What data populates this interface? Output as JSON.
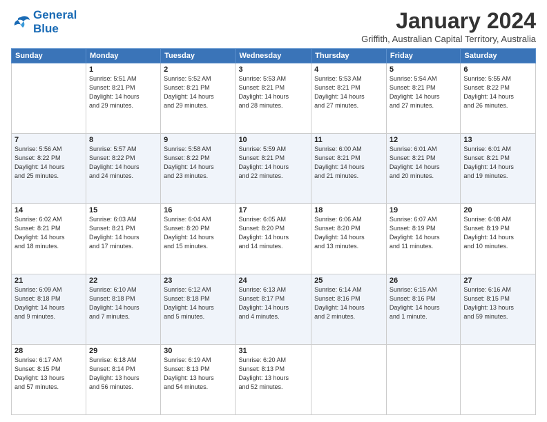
{
  "logo": {
    "line1": "General",
    "line2": "Blue"
  },
  "title": "January 2024",
  "location": "Griffith, Australian Capital Territory, Australia",
  "days_of_week": [
    "Sunday",
    "Monday",
    "Tuesday",
    "Wednesday",
    "Thursday",
    "Friday",
    "Saturday"
  ],
  "weeks": [
    [
      {
        "day": "",
        "info": ""
      },
      {
        "day": "1",
        "info": "Sunrise: 5:51 AM\nSunset: 8:21 PM\nDaylight: 14 hours\nand 29 minutes."
      },
      {
        "day": "2",
        "info": "Sunrise: 5:52 AM\nSunset: 8:21 PM\nDaylight: 14 hours\nand 29 minutes."
      },
      {
        "day": "3",
        "info": "Sunrise: 5:53 AM\nSunset: 8:21 PM\nDaylight: 14 hours\nand 28 minutes."
      },
      {
        "day": "4",
        "info": "Sunrise: 5:53 AM\nSunset: 8:21 PM\nDaylight: 14 hours\nand 27 minutes."
      },
      {
        "day": "5",
        "info": "Sunrise: 5:54 AM\nSunset: 8:21 PM\nDaylight: 14 hours\nand 27 minutes."
      },
      {
        "day": "6",
        "info": "Sunrise: 5:55 AM\nSunset: 8:22 PM\nDaylight: 14 hours\nand 26 minutes."
      }
    ],
    [
      {
        "day": "7",
        "info": "Sunrise: 5:56 AM\nSunset: 8:22 PM\nDaylight: 14 hours\nand 25 minutes."
      },
      {
        "day": "8",
        "info": "Sunrise: 5:57 AM\nSunset: 8:22 PM\nDaylight: 14 hours\nand 24 minutes."
      },
      {
        "day": "9",
        "info": "Sunrise: 5:58 AM\nSunset: 8:22 PM\nDaylight: 14 hours\nand 23 minutes."
      },
      {
        "day": "10",
        "info": "Sunrise: 5:59 AM\nSunset: 8:21 PM\nDaylight: 14 hours\nand 22 minutes."
      },
      {
        "day": "11",
        "info": "Sunrise: 6:00 AM\nSunset: 8:21 PM\nDaylight: 14 hours\nand 21 minutes."
      },
      {
        "day": "12",
        "info": "Sunrise: 6:01 AM\nSunset: 8:21 PM\nDaylight: 14 hours\nand 20 minutes."
      },
      {
        "day": "13",
        "info": "Sunrise: 6:01 AM\nSunset: 8:21 PM\nDaylight: 14 hours\nand 19 minutes."
      }
    ],
    [
      {
        "day": "14",
        "info": "Sunrise: 6:02 AM\nSunset: 8:21 PM\nDaylight: 14 hours\nand 18 minutes."
      },
      {
        "day": "15",
        "info": "Sunrise: 6:03 AM\nSunset: 8:21 PM\nDaylight: 14 hours\nand 17 minutes."
      },
      {
        "day": "16",
        "info": "Sunrise: 6:04 AM\nSunset: 8:20 PM\nDaylight: 14 hours\nand 15 minutes."
      },
      {
        "day": "17",
        "info": "Sunrise: 6:05 AM\nSunset: 8:20 PM\nDaylight: 14 hours\nand 14 minutes."
      },
      {
        "day": "18",
        "info": "Sunrise: 6:06 AM\nSunset: 8:20 PM\nDaylight: 14 hours\nand 13 minutes."
      },
      {
        "day": "19",
        "info": "Sunrise: 6:07 AM\nSunset: 8:19 PM\nDaylight: 14 hours\nand 11 minutes."
      },
      {
        "day": "20",
        "info": "Sunrise: 6:08 AM\nSunset: 8:19 PM\nDaylight: 14 hours\nand 10 minutes."
      }
    ],
    [
      {
        "day": "21",
        "info": "Sunrise: 6:09 AM\nSunset: 8:18 PM\nDaylight: 14 hours\nand 9 minutes."
      },
      {
        "day": "22",
        "info": "Sunrise: 6:10 AM\nSunset: 8:18 PM\nDaylight: 14 hours\nand 7 minutes."
      },
      {
        "day": "23",
        "info": "Sunrise: 6:12 AM\nSunset: 8:18 PM\nDaylight: 14 hours\nand 5 minutes."
      },
      {
        "day": "24",
        "info": "Sunrise: 6:13 AM\nSunset: 8:17 PM\nDaylight: 14 hours\nand 4 minutes."
      },
      {
        "day": "25",
        "info": "Sunrise: 6:14 AM\nSunset: 8:16 PM\nDaylight: 14 hours\nand 2 minutes."
      },
      {
        "day": "26",
        "info": "Sunrise: 6:15 AM\nSunset: 8:16 PM\nDaylight: 14 hours\nand 1 minute."
      },
      {
        "day": "27",
        "info": "Sunrise: 6:16 AM\nSunset: 8:15 PM\nDaylight: 13 hours\nand 59 minutes."
      }
    ],
    [
      {
        "day": "28",
        "info": "Sunrise: 6:17 AM\nSunset: 8:15 PM\nDaylight: 13 hours\nand 57 minutes."
      },
      {
        "day": "29",
        "info": "Sunrise: 6:18 AM\nSunset: 8:14 PM\nDaylight: 13 hours\nand 56 minutes."
      },
      {
        "day": "30",
        "info": "Sunrise: 6:19 AM\nSunset: 8:13 PM\nDaylight: 13 hours\nand 54 minutes."
      },
      {
        "day": "31",
        "info": "Sunrise: 6:20 AM\nSunset: 8:13 PM\nDaylight: 13 hours\nand 52 minutes."
      },
      {
        "day": "",
        "info": ""
      },
      {
        "day": "",
        "info": ""
      },
      {
        "day": "",
        "info": ""
      }
    ]
  ]
}
